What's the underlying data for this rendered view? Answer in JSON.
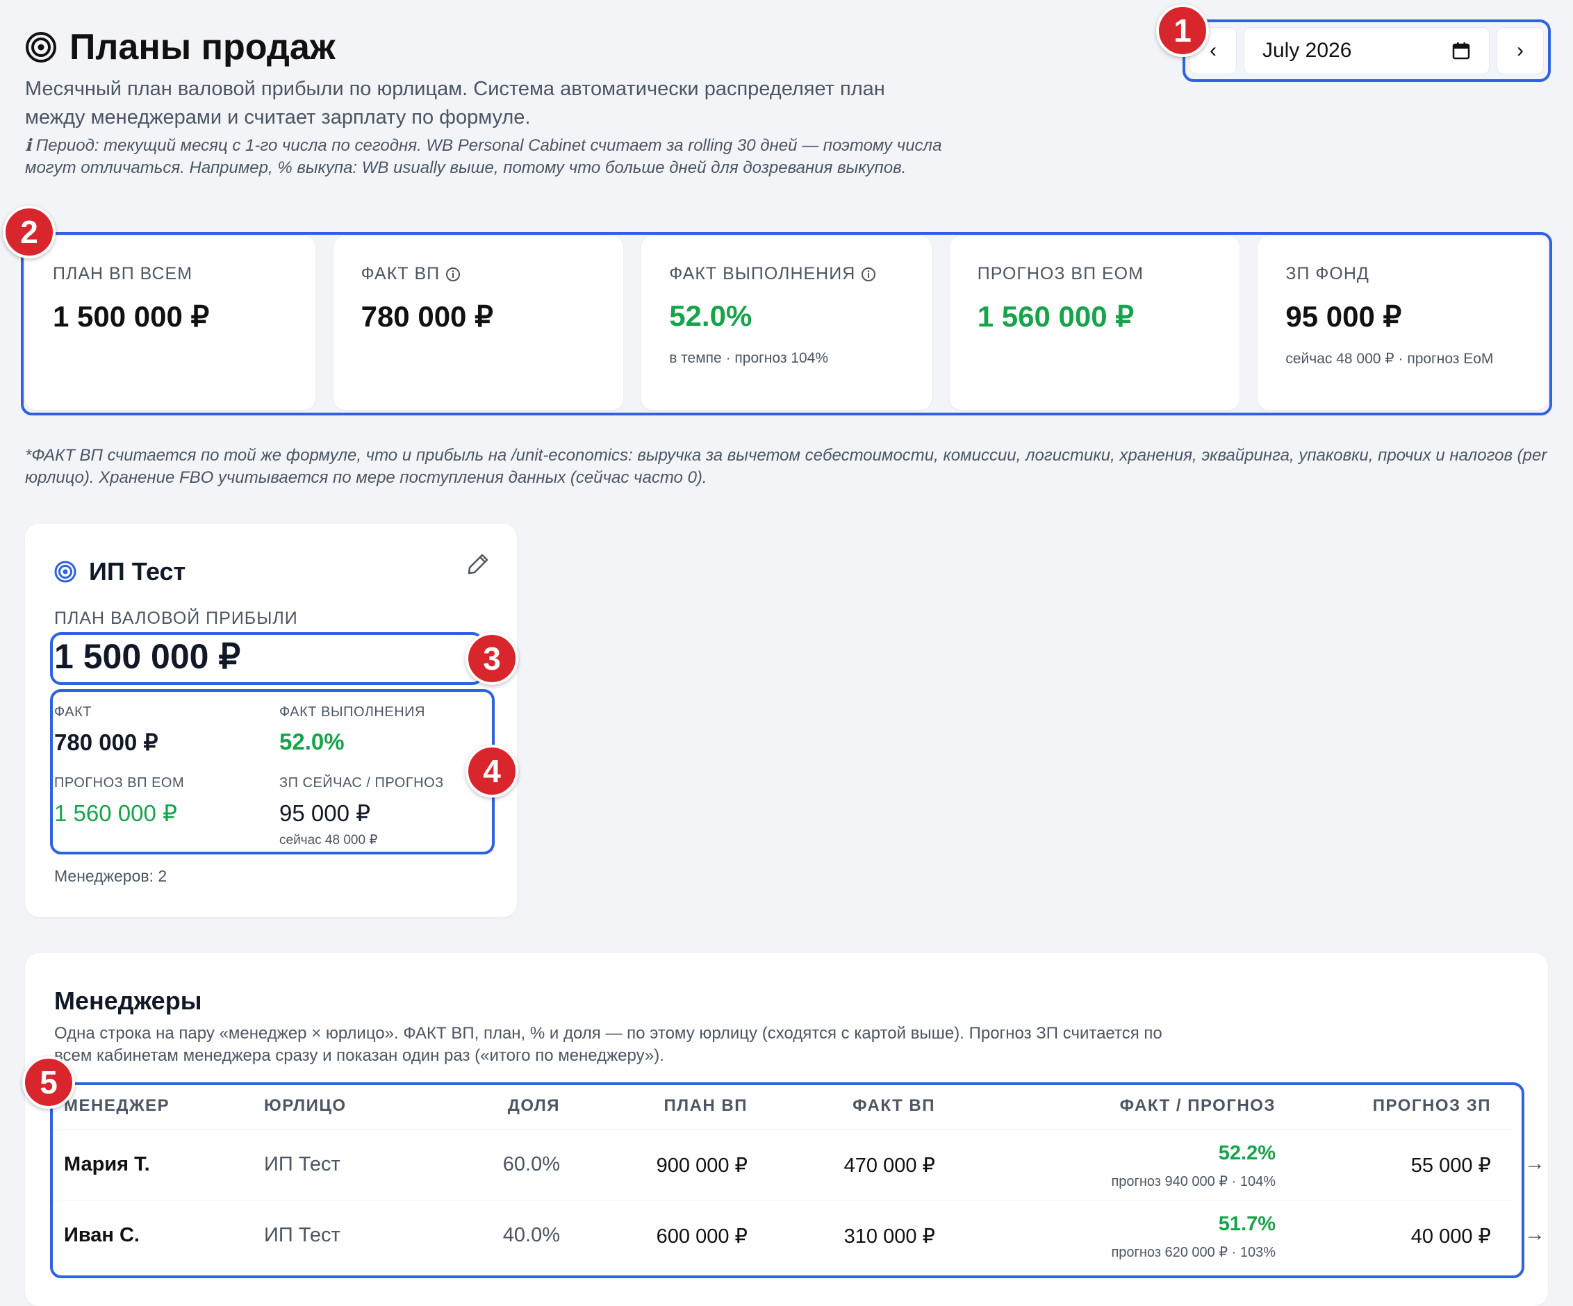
{
  "page": {
    "title": "Планы продаж",
    "subtitle": "Месячный план валовой прибыли по юрлицам. Система автоматически распределяет план между менеджерами и считает зарплату по формуле.",
    "note_icon": "ℹ",
    "note": "Период: текущий месяц с 1-го числа по сегодня. WB Personal Cabinet считает за rolling 30 дней — поэтому числа могут отличаться. Например, % выкупа: WB usually выше, потому что больше дней для дозревания выкупов.",
    "footnote": "*ФАКТ ВП считается по той же формуле, что и прибыль на /unit-economics: выручка за вычетом себестоимости, комиссии, логистики, хранения, эквайринга, упаковки, прочих и налогов (per юрлицо). Хранение FBO учитывается по мере поступления данных (сейчас часто 0)."
  },
  "date_picker": {
    "value": "July 2026",
    "prev_glyph": "‹",
    "next_glyph": "›"
  },
  "badges": [
    "1",
    "2",
    "3",
    "4",
    "5"
  ],
  "kpis": [
    {
      "label": "ПЛАН ВП ВСЕМ",
      "value": "1 500 000 ₽",
      "sub": "",
      "info": false,
      "green": false
    },
    {
      "label": "ФАКТ ВП",
      "value": "780 000 ₽",
      "sub": "",
      "info": true,
      "green": false
    },
    {
      "label": "ФАКТ ВЫПОЛНЕНИЯ",
      "value": "52.0%",
      "sub": "в темпе · прогноз 104%",
      "info": true,
      "green": true
    },
    {
      "label": "ПРОГНОЗ ВП EOM",
      "value": "1 560 000 ₽",
      "sub": "",
      "info": false,
      "green": true
    },
    {
      "label": "ЗП ФОНД",
      "value": "95 000 ₽",
      "sub": "сейчас 48 000 ₽ · прогноз EoM",
      "info": false,
      "green": false
    }
  ],
  "entity": {
    "name": "ИП Тест",
    "plan_label": "ПЛАН ВАЛОВОЙ ПРИБЫЛИ",
    "plan_value": "1 500 000 ₽",
    "fact_label": "ФАКТ",
    "fact_value": "780 000 ₽",
    "exec_label": "ФАКТ ВЫПОЛНЕНИЯ",
    "exec_value": "52.0%",
    "forecast_label": "ПРОГНОЗ ВП EOM",
    "forecast_value": "1 560 000 ₽",
    "salary_label": "ЗП СЕЙЧАС / ПРОГНОЗ",
    "salary_value": "95 000 ₽",
    "salary_sub": "сейчас 48 000 ₽",
    "managers_count": "Менеджеров: 2"
  },
  "managers": {
    "title": "Менеджеры",
    "description": "Одна строка на пару «менеджер × юрлицо». ФАКТ ВП, план, % и доля — по этому юрлицу (сходятся с картой выше). Прогноз ЗП считается по всем кабинетам менеджера сразу и показан один раз («итого по менеджеру»).",
    "columns": [
      "МЕНЕДЖЕР",
      "ЮРЛИЦО",
      "ДОЛЯ",
      "ПЛАН ВП",
      "ФАКТ ВП",
      "ФАКТ / ПРОГНОЗ",
      "ПРОГНОЗ ЗП"
    ],
    "rows": [
      {
        "manager": "Мария Т.",
        "entity": "ИП Тест",
        "share": "60.0%",
        "plan": "900 000 ₽",
        "fact": "470 000 ₽",
        "pct": "52.2%",
        "forecast": "прогноз 940 000 ₽ · 104%",
        "salary": "55 000 ₽",
        "arrow": "→"
      },
      {
        "manager": "Иван С.",
        "entity": "ИП Тест",
        "share": "40.0%",
        "plan": "600 000 ₽",
        "fact": "310 000 ₽",
        "pct": "51.7%",
        "forecast": "прогноз 620 000 ₽ · 103%",
        "salary": "40 000 ₽",
        "arrow": "→"
      }
    ]
  },
  "colors": {
    "accent": "#2f62e0",
    "badge": "#d8262c",
    "green": "#16a34a"
  }
}
